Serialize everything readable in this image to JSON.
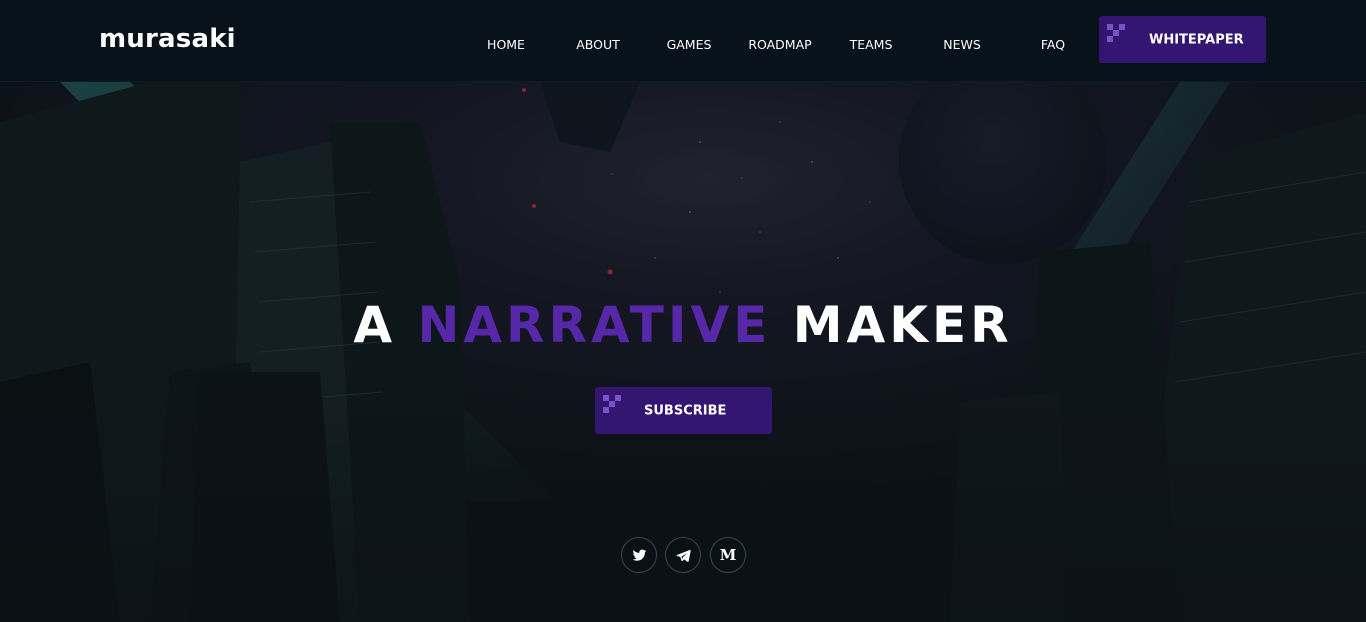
{
  "header": {
    "logo": "murasaki",
    "nav": [
      "HOME",
      "ABOUT",
      "GAMES",
      "ROADMAP",
      "TEAMS",
      "NEWS",
      "FAQ"
    ],
    "cta_label": "WHITEPAPER"
  },
  "hero": {
    "headline_start": "A ",
    "headline_highlight": "NARRATIVE",
    "headline_end": " MAKER",
    "subscribe_label": "SUBSCRIBE"
  },
  "socials": {
    "icons": [
      "twitter-icon",
      "telegram-icon",
      "medium-icon"
    ],
    "medium_glyph": "M"
  },
  "colors": {
    "brand_purple": "#321672",
    "highlight_purple": "#5627a6",
    "header_bg": "#08121a"
  }
}
